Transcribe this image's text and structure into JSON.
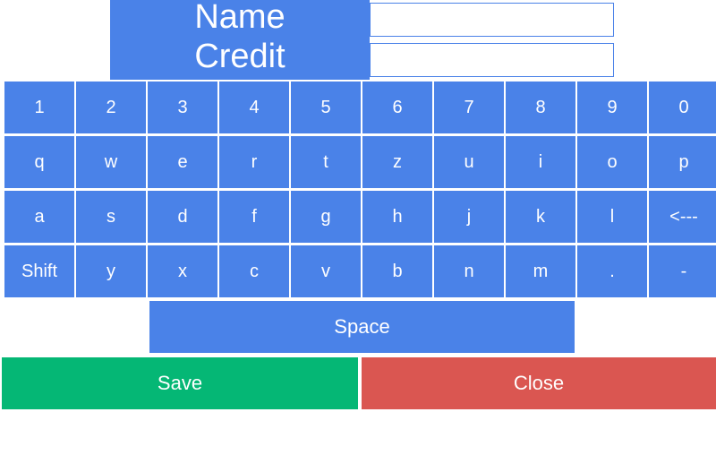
{
  "form": {
    "name_label": "Name",
    "credit_label": "Credit",
    "name_value": "",
    "credit_value": ""
  },
  "keyboard": {
    "rows": [
      [
        "1",
        "2",
        "3",
        "4",
        "5",
        "6",
        "7",
        "8",
        "9",
        "0"
      ],
      [
        "q",
        "w",
        "e",
        "r",
        "t",
        "z",
        "u",
        "i",
        "o",
        "p"
      ],
      [
        "a",
        "s",
        "d",
        "f",
        "g",
        "h",
        "j",
        "k",
        "l",
        "<---"
      ],
      [
        "Shift",
        "y",
        "x",
        "c",
        "v",
        "b",
        "n",
        "m",
        ".",
        "-"
      ]
    ],
    "space_label": "Space"
  },
  "actions": {
    "save_label": "Save",
    "close_label": "Close"
  },
  "colors": {
    "key_blue": "#4a82e8",
    "save_green": "#05b775",
    "close_red": "#da5651"
  }
}
